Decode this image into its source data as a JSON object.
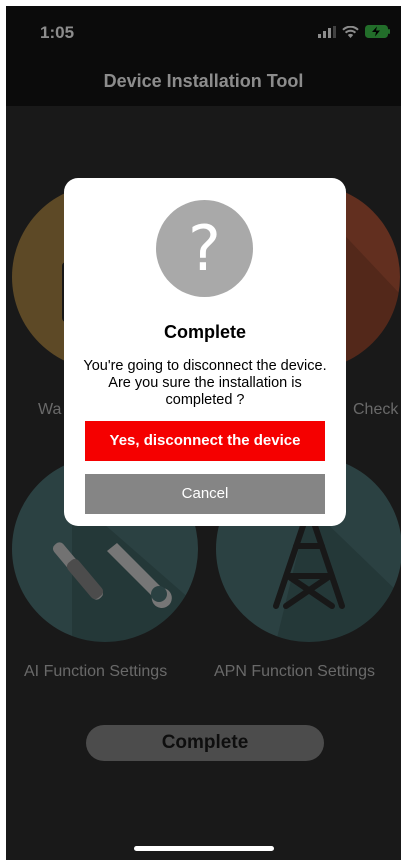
{
  "status_bar": {
    "time": "1:05"
  },
  "nav": {
    "title": "Device Installation Tool"
  },
  "functions": {
    "wa_label": "Wa",
    "check_label": "Check",
    "ai_label": "AI Function Settings",
    "apn_label": "APN Function Settings"
  },
  "complete_button": "Complete",
  "dialog": {
    "icon": "?",
    "title": "Complete",
    "message": "You're going to disconnect the device. Are you sure the installation is completed ?",
    "confirm_label": "Yes, disconnect the device",
    "cancel_label": "Cancel"
  },
  "colors": {
    "confirm": "#f50000",
    "cancel": "#858585",
    "orange_circle": "#a98545",
    "red_circle": "#b2563a",
    "teal_circle": "#4f7779"
  }
}
